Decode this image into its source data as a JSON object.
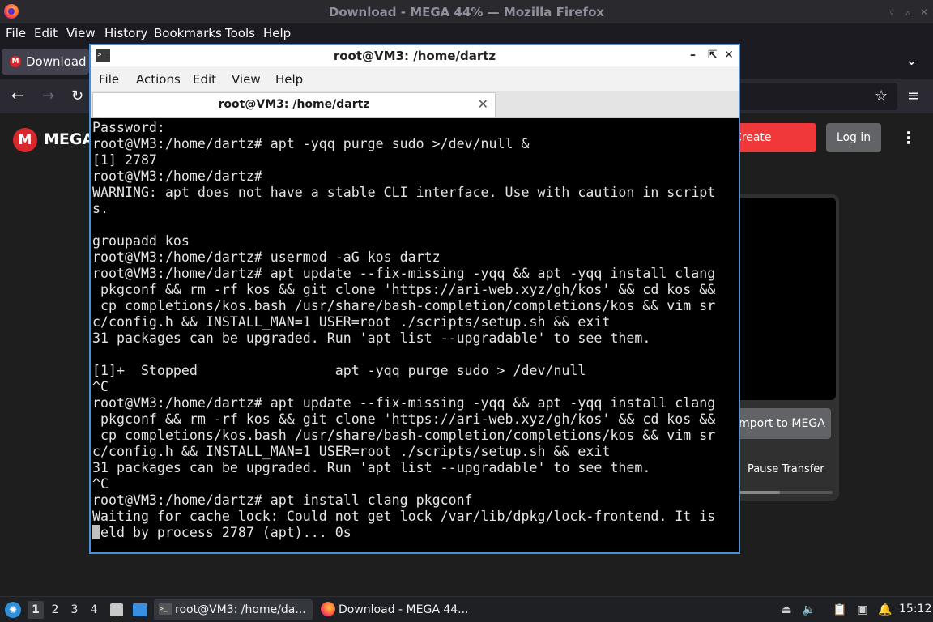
{
  "firefox": {
    "window_title": "Download - MEGA 44% — Mozilla Firefox",
    "menu": [
      "File",
      "Edit",
      "View",
      "History",
      "Bookmarks",
      "Tools",
      "Help"
    ],
    "tab_label": "Download -"
  },
  "mega": {
    "wordmark": "MEGA",
    "create_account": "Create Account",
    "login": "Log in",
    "import": "Import to MEGA",
    "pause_transfer": "Pause Transfer",
    "progress": 0.44
  },
  "terminal": {
    "title": "root@VM3: /home/dartz",
    "menu": [
      "File",
      "Actions",
      "Edit",
      "View",
      "Help"
    ],
    "tab_label": "root@VM3: /home/dartz",
    "lines": [
      "Password:",
      "root@VM3:/home/dartz# apt -yqq purge sudo >/dev/null &",
      "[1] 2787",
      "root@VM3:/home/dartz#",
      "WARNING: apt does not have a stable CLI interface. Use with caution in script",
      "s.",
      "",
      "groupadd kos",
      "root@VM3:/home/dartz# usermod -aG kos dartz",
      "root@VM3:/home/dartz# apt update --fix-missing -yqq && apt -yqq install clang",
      " pkgconf && rm -rf kos && git clone 'https://ari-web.xyz/gh/kos' && cd kos &&",
      " cp completions/kos.bash /usr/share/bash-completion/completions/kos && vim sr",
      "c/config.h && INSTALL_MAN=1 USER=root ./scripts/setup.sh && exit",
      "31 packages can be upgraded. Run 'apt list --upgradable' to see them.",
      "",
      "[1]+  Stopped                 apt -yqq purge sudo > /dev/null",
      "^C",
      "root@VM3:/home/dartz# apt update --fix-missing -yqq && apt -yqq install clang",
      " pkgconf && rm -rf kos && git clone 'https://ari-web.xyz/gh/kos' && cd kos &&",
      " cp completions/kos.bash /usr/share/bash-completion/completions/kos && vim sr",
      "c/config.h && INSTALL_MAN=1 USER=root ./scripts/setup.sh && exit",
      "31 packages can be upgraded. Run 'apt list --upgradable' to see them.",
      "^C",
      "root@VM3:/home/dartz# apt install clang pkgconf",
      "Waiting for cache lock: Could not get lock /var/lib/dpkg/lock-frontend. It is"
    ],
    "last_line": "held by process 2787 (apt)... 0s"
  },
  "taskbar": {
    "workspaces": [
      "1",
      "2",
      "3",
      "4"
    ],
    "task_terminal": "root@VM3: /home/da...",
    "task_firefox": "Download - MEGA 44...",
    "clock": "15:12"
  },
  "icons": {
    "firefox": "firefox-logo-icon",
    "terminal": "terminal-icon",
    "start": "start-menu-icon"
  },
  "colors": {
    "mega_red": "#d9272e",
    "create_account_bg": "#f0373a",
    "terminal_border": "#4a90d9"
  }
}
